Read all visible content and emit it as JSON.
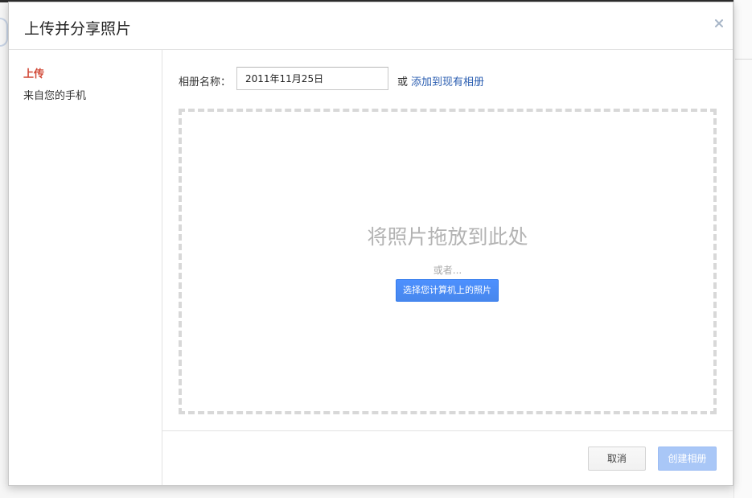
{
  "dialog": {
    "title": "上传并分享照片",
    "close_icon": "close-icon"
  },
  "sidebar": {
    "items": [
      {
        "label": "上传",
        "active": true
      },
      {
        "label": "来自您的手机",
        "active": false
      }
    ]
  },
  "album": {
    "label": "相册名称：",
    "name_value": "2011年11月25日",
    "or_text": "或",
    "existing_link": "添加到现有相册"
  },
  "dropzone": {
    "title": "将照片拖放到此处",
    "or_text": "或者...",
    "choose_button": "选择您计算机上的照片"
  },
  "footer": {
    "cancel_label": "取消",
    "create_label": "创建相册",
    "create_enabled": false
  },
  "colors": {
    "accent_red": "#d14836",
    "link_blue": "#2a5db0",
    "primary_blue": "#4d90fe",
    "disabled_blue": "#a9c7f7"
  }
}
